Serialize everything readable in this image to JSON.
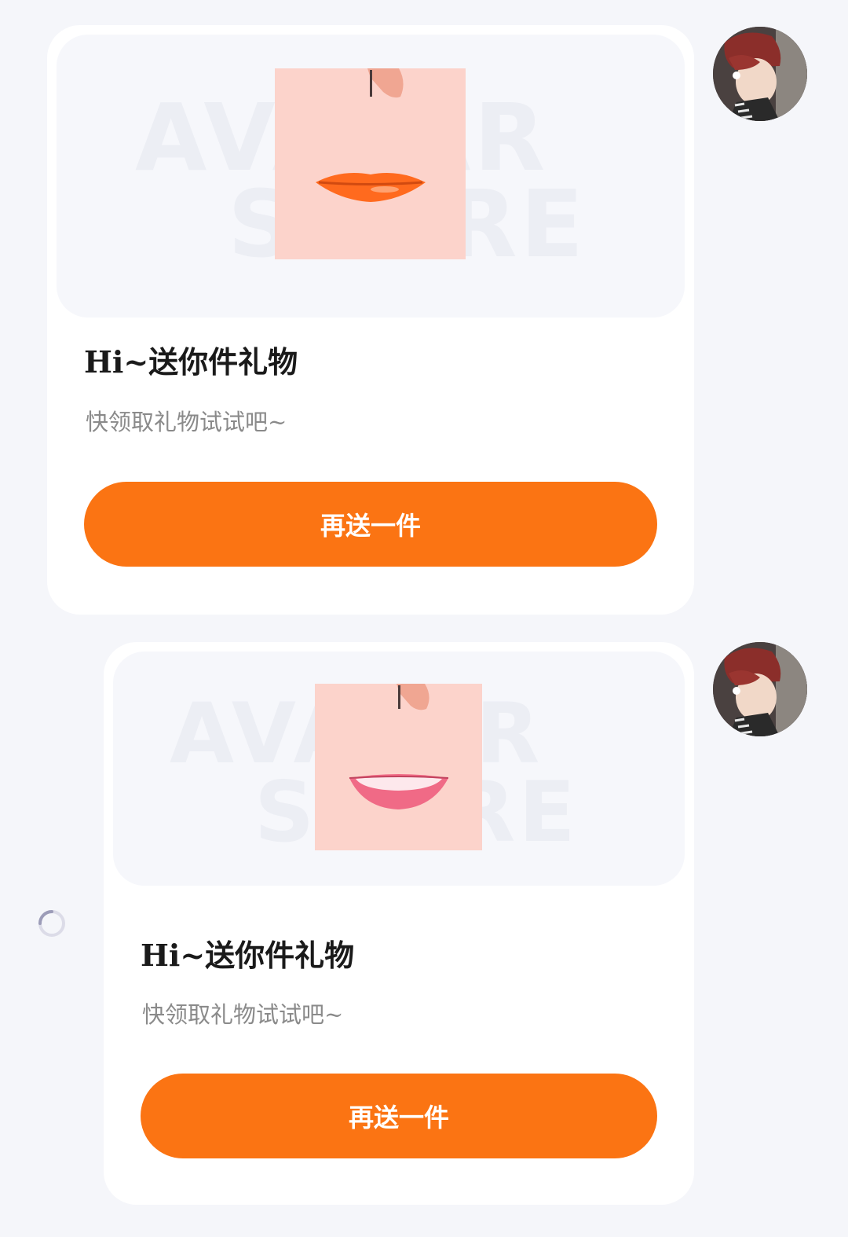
{
  "messages": [
    {
      "watermark_line1": "AVATAR",
      "watermark_line2": "STORE",
      "gift_image": "lip-gloss-orange-icon",
      "lip_color": "#ff6a1e",
      "title": "Hi~送你件礼物",
      "subtitle": "快领取礼物试试吧~",
      "button_label": "再送一件",
      "avatar": "user-avatar",
      "status": "sent"
    },
    {
      "watermark_line1": "AVATAR",
      "watermark_line2": "STORE",
      "gift_image": "lip-smile-pink-icon",
      "lip_color": "#f06a86",
      "title": "Hi~送你件礼物",
      "subtitle": "快领取礼物试试吧~",
      "button_label": "再送一件",
      "avatar": "user-avatar",
      "status": "sending",
      "status_icon": "loading-spinner-icon"
    }
  ],
  "colors": {
    "page_background": "#f5f6fa",
    "card_background": "#ffffff",
    "button_background": "#fb7413",
    "button_text": "#ffffff",
    "title_text": "#1a1a1a",
    "subtitle_text": "#8a8a8a"
  }
}
